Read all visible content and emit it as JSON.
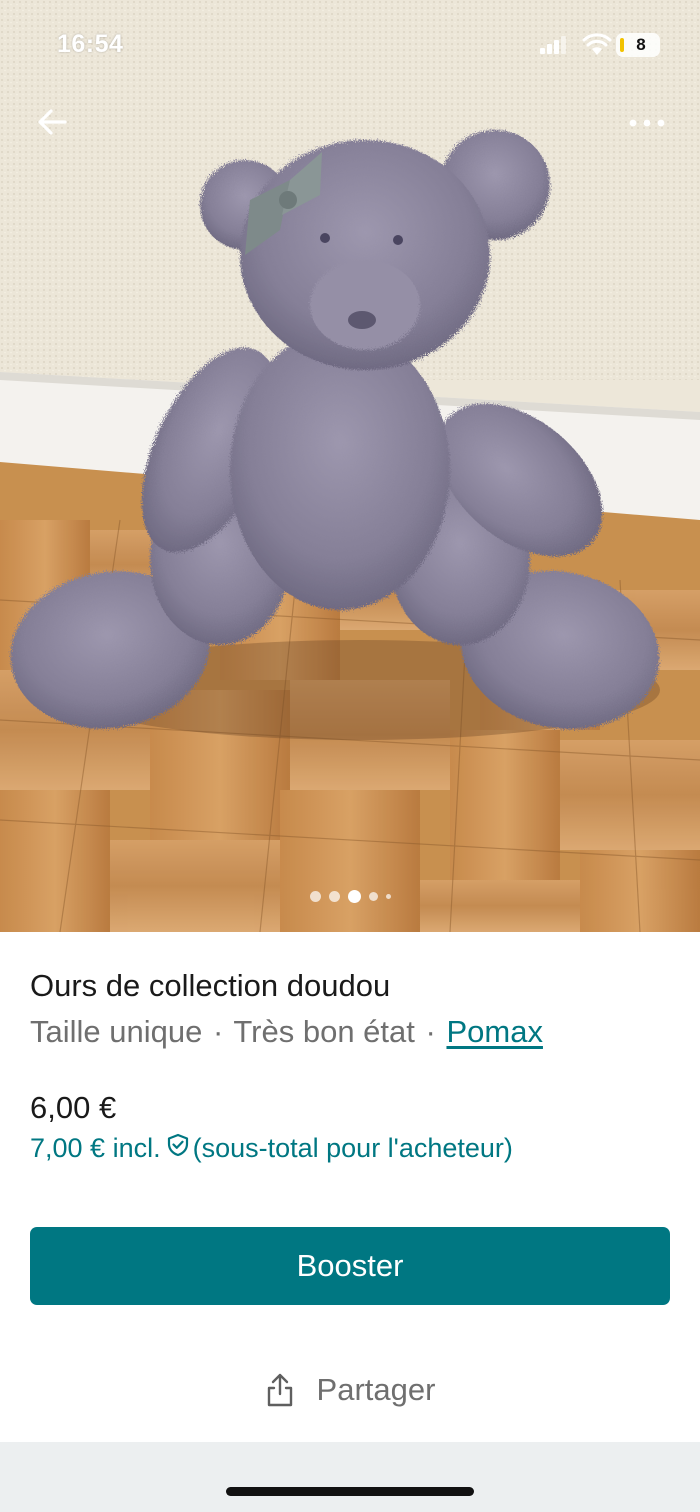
{
  "status_bar": {
    "time": "16:54",
    "battery_level": "8",
    "battery_color": "#f2c200"
  },
  "photo": {
    "icons": {
      "back": "arrow-left-icon",
      "more": "more-horizontal-icon"
    },
    "carousel": {
      "count": 5,
      "active_index": 2
    }
  },
  "item": {
    "title": "Ours de collection doudou",
    "size": "Taille unique",
    "condition": "Très bon état",
    "brand": "Pomax",
    "price": "6,00 €",
    "price_incl": "7,00 € incl.",
    "price_incl_note": "(sous-total pour l'acheteur)"
  },
  "actions": {
    "booster_label": "Booster",
    "share_label": "Partager"
  },
  "colors": {
    "accent": "#007782",
    "text_primary": "#1a1a1a",
    "text_secondary": "#6f6f6f"
  }
}
